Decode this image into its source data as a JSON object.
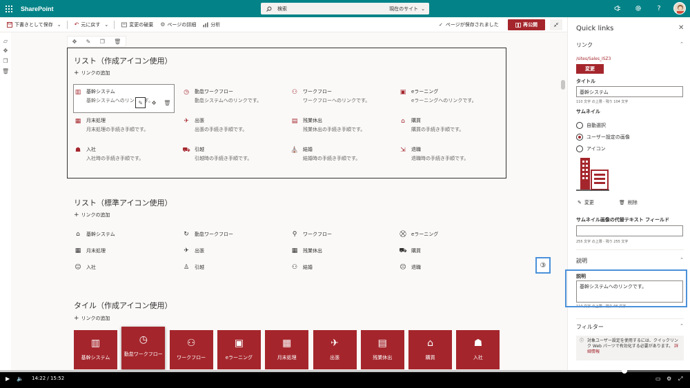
{
  "topbar": {
    "app_title": "SharePoint",
    "search_placeholder": "検索",
    "search_scope": "現在のサイト"
  },
  "cmdbar": {
    "save_draft": "下書きとして保存",
    "undo": "元に戻す",
    "discard": "変更の破棄",
    "page_details": "ページの詳細",
    "analytics": "分析",
    "saved_status": "ページが保存されました",
    "publish": "再公開"
  },
  "section1": {
    "title": "リスト（作成アイコン使用）",
    "add_link": "リンクの追加",
    "items": [
      {
        "title": "基幹システム",
        "desc": "基幹システムへのリンクです。",
        "icon": "building-icon"
      },
      {
        "title": "勤怠ワークフロー",
        "desc": "勤怠システムへのリンクです。",
        "icon": "clock-icon"
      },
      {
        "title": "ワークフロー",
        "desc": "ワークフローへのリンクです。",
        "icon": "workflow-icon"
      },
      {
        "title": "eラーニング",
        "desc": "eラーニングへのリンクです。",
        "icon": "elearning-icon"
      },
      {
        "title": "月末処理",
        "desc": "月末処理の手続き手順です。",
        "icon": "calendar-icon"
      },
      {
        "title": "出張",
        "desc": "出張の手続き手順です。",
        "icon": "airplane-icon"
      },
      {
        "title": "残業休出",
        "desc": "残業休出の手続き手順です。",
        "icon": "timesheet-icon"
      },
      {
        "title": "購買",
        "desc": "購買の手続き手順です。",
        "icon": "basket-icon"
      },
      {
        "title": "入社",
        "desc": "入社時の手続き手順です。",
        "icon": "person-icon"
      },
      {
        "title": "引越",
        "desc": "引越時の手続き手順です。",
        "icon": "truck-icon"
      },
      {
        "title": "結婚",
        "desc": "結婚時の手続き手順です。",
        "icon": "wedding-icon"
      },
      {
        "title": "退職",
        "desc": "退職時の手続き手順です。",
        "icon": "exit-icon"
      }
    ]
  },
  "section2": {
    "title": "リスト（標準アイコン使用）",
    "add_link": "リンクの追加",
    "items": [
      {
        "title": "基幹システム",
        "icon": "city-icon"
      },
      {
        "title": "勤怠ワークフロー",
        "icon": "clock-arrow-icon"
      },
      {
        "title": "ワークフロー",
        "icon": "flow-icon"
      },
      {
        "title": "eラーニング",
        "icon": "graduation-icon"
      },
      {
        "title": "月末処理",
        "icon": "calendar-icon"
      },
      {
        "title": "出張",
        "icon": "airplane-icon"
      },
      {
        "title": "残業休出",
        "icon": "calendar-settings-icon"
      },
      {
        "title": "購買",
        "icon": "cart-icon"
      },
      {
        "title": "入社",
        "icon": "person-add-icon"
      },
      {
        "title": "引越",
        "icon": "person-move-icon"
      },
      {
        "title": "結婚",
        "icon": "people-icon"
      },
      {
        "title": "退職",
        "icon": "person-remove-icon"
      }
    ]
  },
  "section3": {
    "title": "タイル（作成アイコン使用）",
    "add_link": "リンクの追加",
    "tiles": [
      {
        "label": "基幹システム",
        "icon": "building-icon"
      },
      {
        "label": "勤怠ワークフロー",
        "icon": "clock-icon"
      },
      {
        "label": "ワークフロー",
        "icon": "workflow-icon"
      },
      {
        "label": "eラーニング",
        "icon": "elearning-icon"
      },
      {
        "label": "月末処理",
        "icon": "calendar-icon"
      },
      {
        "label": "出張",
        "icon": "airplane-icon"
      },
      {
        "label": "残業休出",
        "icon": "timesheet-icon"
      },
      {
        "label": "購買",
        "icon": "basket-icon"
      },
      {
        "label": "入社",
        "icon": "person-icon"
      }
    ]
  },
  "panel": {
    "title": "Quick links",
    "link_group": "リンク",
    "link_url": "/sites/Sales_ISZ3",
    "change_button": "変更",
    "title_label": "タイトル",
    "title_value": "基幹システム",
    "title_counter": "110 文字 の上限 - 残り 104 文字",
    "thumbnail_label": "サムネイル",
    "thumb_options": [
      "自動選択",
      "ユーザー設定の画像",
      "アイコン"
    ],
    "thumb_selected": 1,
    "thumb_change": "変更",
    "thumb_remove": "削除",
    "alt_label": "サムネイル画像の代替テキスト フィールド",
    "alt_counter": "255 文字 の上限 - 残り 255 文字",
    "desc_group": "説明",
    "desc_label": "説明",
    "desc_value": "基幹システムへのリンクです。",
    "desc_counter": "110 文字 の上限 - 残り 96 文字",
    "filter_group": "フィルター",
    "filter_info": "対象ユーザー設定を使用するには、クイックリンク Web パーツで有効化する必要があります。",
    "filter_link": "詳細情報",
    "callout": "③"
  },
  "video": {
    "time": "14:22 / 15:52",
    "progress": 0.905
  },
  "colors": {
    "topbar": "#038387",
    "accent": "#a4262c",
    "callout": "#4a90d9"
  }
}
